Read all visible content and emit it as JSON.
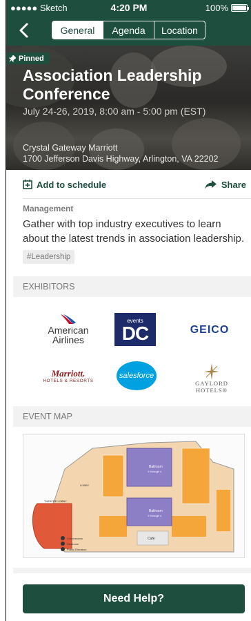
{
  "status_bar": {
    "carrier": "●●●●● Sketch",
    "time": "4:20 PM",
    "battery": "100%"
  },
  "nav": {
    "tabs": [
      {
        "label": "General",
        "active": true
      },
      {
        "label": "Agenda",
        "active": false
      },
      {
        "label": "Location",
        "active": false
      }
    ]
  },
  "hero": {
    "badge": "Pinned",
    "title": "Association Leadership Conference",
    "date": "July 24-26, 2019, 8:00 am - 5:00 pm (EST)",
    "venue": "Crystal Gateway Marriott",
    "address": "1700 Jefferson Davis Highway, Arlington, VA 22202"
  },
  "actions": {
    "add_to_schedule": "Add to schedule",
    "share": "Share"
  },
  "about": {
    "category": "Management",
    "description": "Gather with top industry executives to learn about the latest trends in association leadership.",
    "tag": "#Leadership"
  },
  "exhibitors": {
    "heading": "EXHIBITORS",
    "logos": {
      "american_line1": "American",
      "american_line2": "Airlines",
      "events_top": "events",
      "events_main": "DC",
      "geico": "GEICO",
      "marriott_main": "Marriott.",
      "marriott_sub": "HOTELS & RESORTS",
      "salesforce": "salesforce",
      "gaylord_main": "GAYLORD",
      "gaylord_sub": "HOTELS®"
    }
  },
  "event_map": {
    "heading": "EVENT MAP",
    "labels": {
      "ballroom_a": "Ballroom",
      "ballroom_a_sub": "1 through 4",
      "ballroom_b": "Ballroom",
      "ballroom_b_sub": "1 through 4",
      "theatre": "THEATRE LOBBY",
      "lobby": "LOBBY",
      "cafe": "Cafe",
      "legend_1": "Concessions",
      "legend_2": "Restroom",
      "legend_3": "Public Elevators"
    }
  },
  "help_button": "Need Help?",
  "colors": {
    "brand": "#1e4f3e",
    "accent_text": "#7a7a7a"
  }
}
